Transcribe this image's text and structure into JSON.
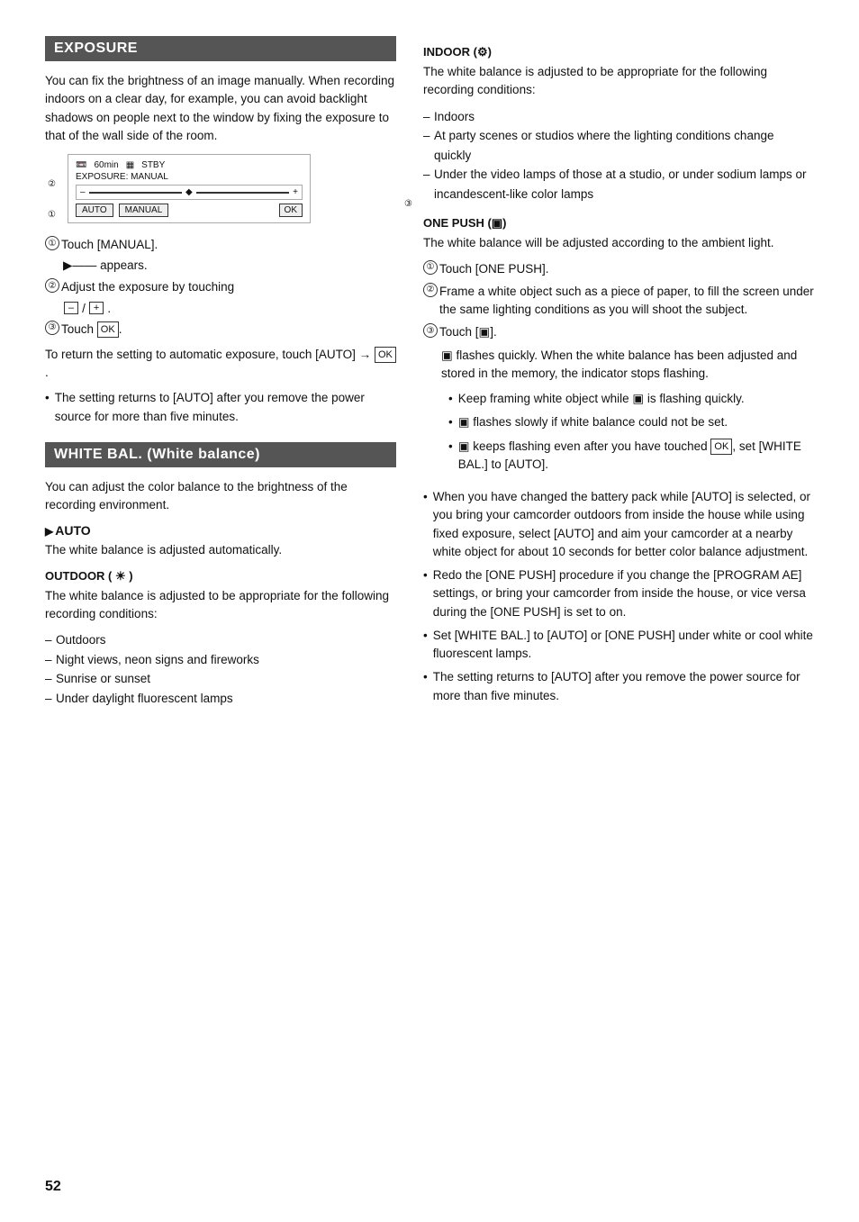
{
  "page_num": "52",
  "left": {
    "exposure_header": "EXPOSURE",
    "exposure_intro": "You can fix the brightness of an image manually. When recording indoors on a clear day, for example, you can avoid backlight shadows on people next to the window by fixing the exposure to that of the wall side of the room.",
    "diagram": {
      "top_labels": [
        "60min",
        "STBY",
        "EXPOSURE: MANUAL"
      ],
      "btn_auto": "AUTO",
      "btn_manual": "MANUAL",
      "btn_ok": "OK",
      "circle1": "①",
      "circle2": "②",
      "circle3": "③"
    },
    "steps": [
      {
        "num": "①",
        "text": "Touch [MANUAL]."
      },
      {
        "num": "",
        "text": "▶—— appears."
      },
      {
        "num": "②",
        "text": "Adjust the exposure by touching"
      },
      {
        "num": "",
        "text": "[ – ] / [ + ]."
      },
      {
        "num": "③",
        "text": "Touch [OK]."
      }
    ],
    "return_text": "To return the setting to automatic exposure, touch [AUTO] → [OK].",
    "note": "The setting returns to [AUTO] after you remove the power source for more than five minutes.",
    "wb_header": "WHITE BAL. (White balance)",
    "wb_intro": "You can adjust the color balance to the brightness of the recording environment.",
    "auto_title": "▶AUTO",
    "auto_desc": "The white balance is adjusted automatically.",
    "outdoor_title": "OUTDOOR ( ☀ )",
    "outdoor_desc": "The white balance is adjusted to be appropriate for the following recording conditions:",
    "outdoor_list": [
      "Outdoors",
      "Night views, neon signs and fireworks",
      "Sunrise or sunset",
      "Under daylight fluorescent lamps"
    ]
  },
  "right": {
    "indoor_title": "INDOOR (🏠)",
    "indoor_desc": "The white balance is adjusted to be appropriate for the following recording conditions:",
    "indoor_list": [
      "Indoors",
      "At party scenes or studios where the lighting conditions change quickly",
      "Under the video lamps of those at a studio, or under sodium lamps or incandescent-like color lamps"
    ],
    "one_push_title": "ONE PUSH (▣)",
    "one_push_desc": "The white balance will be adjusted according to the ambient light.",
    "one_push_steps": [
      {
        "num": "①",
        "text": "Touch [ONE PUSH]."
      },
      {
        "num": "②",
        "text": "Frame a white object such as a piece of paper, to fill the screen under the same lighting conditions as you will shoot the subject."
      },
      {
        "num": "③",
        "text": "Touch [▣]."
      }
    ],
    "one_push_note1": "▣ flashes quickly. When the white balance has been adjusted and stored in the memory, the indicator stops flashing.",
    "one_push_bullets": [
      "Keep framing white object while ▣ is flashing quickly.",
      "▣ flashes slowly if white balance could not be set.",
      "▣ keeps flashing even after you have touched [OK], set [WHITE BAL.] to [AUTO]."
    ],
    "notes": [
      "When you have changed the battery pack while [AUTO] is selected, or you bring your camcorder outdoors from inside the house while using fixed exposure, select [AUTO] and aim your camcorder at a nearby white object for about 10 seconds for better color balance adjustment.",
      "Redo the [ONE PUSH] procedure if you change the [PROGRAM AE] settings, or bring your camcorder from inside the house, or vice versa during the [ONE PUSH] is set to on.",
      "Set [WHITE BAL.] to [AUTO] or [ONE PUSH] under white or cool white fluorescent lamps.",
      "The setting returns to [AUTO] after you remove the power source for more than five minutes."
    ]
  }
}
